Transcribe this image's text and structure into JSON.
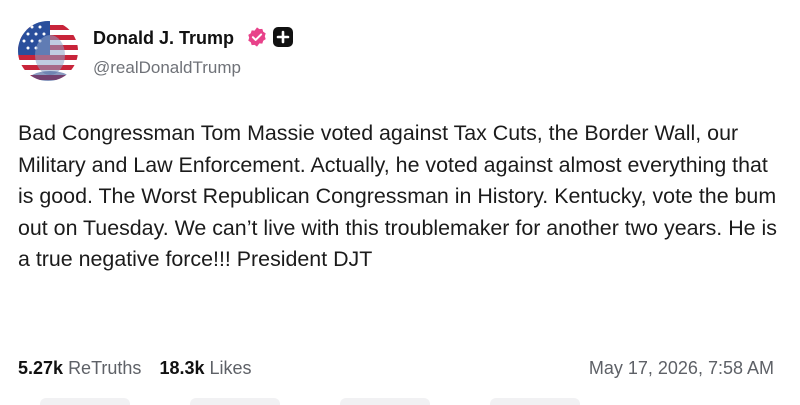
{
  "author": {
    "display_name": "Donald J. Trump",
    "handle": "@realDonaldTrump",
    "avatar_icon": "flag-portrait-avatar",
    "verified_icon": "verified-badge-icon",
    "verified_color": "#e8428a",
    "plus_icon": "plus-badge-icon"
  },
  "post": {
    "text": "Bad Congressman Tom Massie voted against Tax Cuts, the Border Wall, our Military and Law Enforcement. Actually, he voted against almost everything that is good. The Worst Republican Congressman in History. Kentucky, vote the bum out on Tuesday. We can’t live with this troublemaker for another two years. He is a true negative force!!! President DJT"
  },
  "stats": {
    "retruths_count": "5.27k",
    "retruths_label": "ReTruths",
    "likes_count": "18.3k",
    "likes_label": "Likes"
  },
  "timestamp": "May 17, 2026, 7:58 AM"
}
